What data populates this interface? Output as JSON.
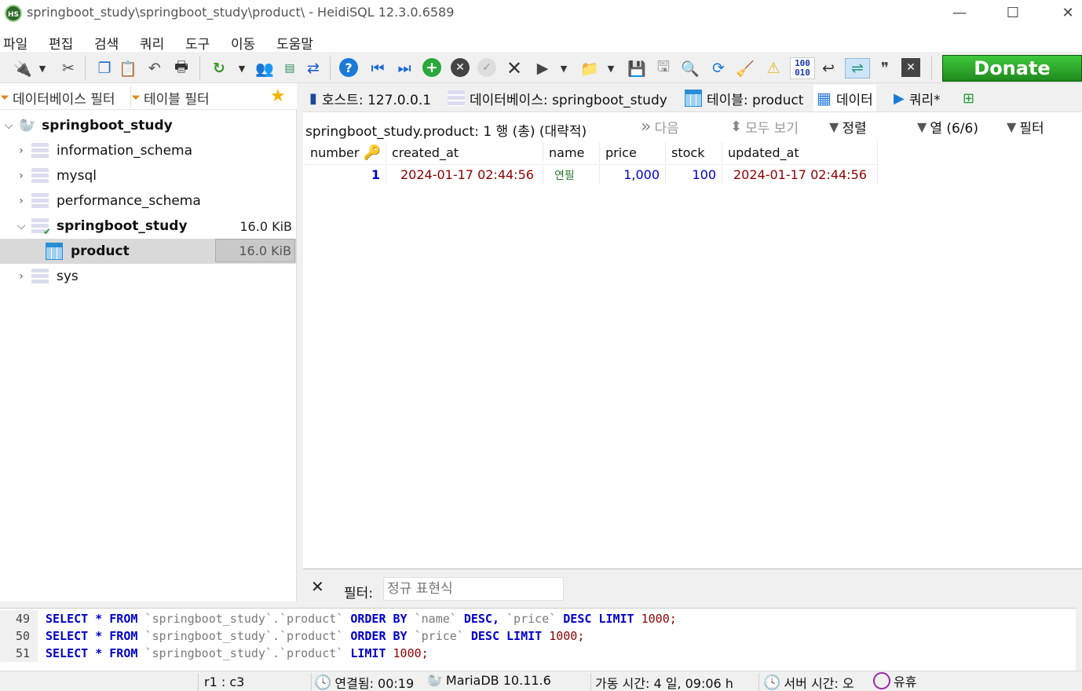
{
  "window": {
    "title": "springboot_study\\springboot_study\\product\\ - HeidiSQL 12.3.0.6589",
    "logo": "HS",
    "minimize": "—",
    "maximize": "☐",
    "close": "✕"
  },
  "menu": [
    "파일",
    "편집",
    "검색",
    "쿼리",
    "도구",
    "이동",
    "도움말"
  ],
  "donate_label": "Donate",
  "toolbar_badge": "100\n010",
  "left": {
    "db_filter": "데이터베이스 필터",
    "table_filter": "테이블 필터",
    "tree": [
      {
        "label": "springboot_study",
        "level": 0,
        "bold": true,
        "size": ""
      },
      {
        "label": "information_schema",
        "level": 1,
        "bold": false,
        "size": ""
      },
      {
        "label": "mysql",
        "level": 1,
        "bold": false,
        "size": ""
      },
      {
        "label": "performance_schema",
        "level": 1,
        "bold": false,
        "size": ""
      },
      {
        "label": "springboot_study",
        "level": 1,
        "bold": true,
        "size": "16.0 KiB"
      },
      {
        "label": "product",
        "level": 2,
        "bold": true,
        "size": "16.0 KiB"
      },
      {
        "label": "sys",
        "level": 1,
        "bold": false,
        "size": ""
      }
    ]
  },
  "tabs": {
    "host": "호스트: 127.0.0.1",
    "database": "데이터베이스: springboot_study",
    "table": "테이블: product",
    "data": "데이터",
    "query": "쿼리*"
  },
  "data_view": {
    "summary": "springboot_study.product: 1 행 (총) (대략적)",
    "next": "다음",
    "show_all": "모두 보기",
    "sort": "정렬",
    "columns": "열 (6/6)",
    "filter": "필터",
    "headers": [
      "number",
      "created_at",
      "name",
      "price",
      "stock",
      "updated_at"
    ],
    "rows": [
      [
        "1",
        "2024-01-17 02:44:56",
        "연필",
        "1,000",
        "100",
        "2024-01-17 02:44:56"
      ]
    ]
  },
  "filter_bar": {
    "close": "✕",
    "label": "필터:",
    "placeholder": "정규 표현식"
  },
  "sql_log": [
    {
      "line": "49",
      "tokens": [
        [
          "kw",
          "SELECT "
        ],
        [
          "kw",
          "* "
        ],
        [
          "kw",
          "FROM "
        ],
        [
          "id",
          "`springboot_study`.`product` "
        ],
        [
          "kw",
          "ORDER BY "
        ],
        [
          "id",
          "`name` "
        ],
        [
          "kw",
          "DESC, "
        ],
        [
          "id",
          "`price` "
        ],
        [
          "kw",
          "DESC LIMIT "
        ],
        [
          "num",
          "1000;"
        ]
      ]
    },
    {
      "line": "50",
      "tokens": [
        [
          "kw",
          "SELECT "
        ],
        [
          "kw",
          "* "
        ],
        [
          "kw",
          "FROM "
        ],
        [
          "id",
          "`springboot_study`.`product` "
        ],
        [
          "kw",
          "ORDER BY "
        ],
        [
          "id",
          "`price` "
        ],
        [
          "kw",
          "DESC LIMIT "
        ],
        [
          "num",
          "1000;"
        ]
      ]
    },
    {
      "line": "51",
      "tokens": [
        [
          "kw",
          "SELECT "
        ],
        [
          "kw",
          "* "
        ],
        [
          "kw",
          "FROM "
        ],
        [
          "id",
          "`springboot_study`.`product` "
        ],
        [
          "kw",
          "LIMIT "
        ],
        [
          "num",
          "1000;"
        ]
      ]
    }
  ],
  "status": {
    "cursor": "r1 : c3",
    "connected": "연결됨: 00:19",
    "server": "MariaDB 10.11.6",
    "uptime": "가동 시간: 4 일, 09:06 h",
    "server_time": "서버 시간: 오",
    "idle": "유휴"
  },
  "colors": {
    "accent_green": "#1f8a1d",
    "id_blue": "#0000c8",
    "date_red": "#8b0000",
    "name_green": "#2a7a2a"
  }
}
